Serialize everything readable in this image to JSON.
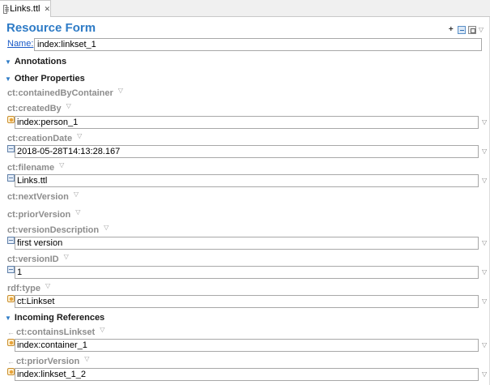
{
  "tab": {
    "title": "Links.ttl",
    "close_glyph": "✕",
    "icon": "turtle-file-icon"
  },
  "form": {
    "title": "Resource Form"
  },
  "toolbar": {
    "add_icon": "add-value-icon",
    "list_icon": "list-view-icon",
    "grid_icon": "grid-view-icon",
    "menu_icon": "chevron-down-icon"
  },
  "name": {
    "label": "Name:",
    "value": "index:linkset_1"
  },
  "sections": {
    "annotations": "Annotations",
    "other_properties": "Other Properties",
    "incoming_references": "Incoming References"
  },
  "properties": {
    "containedByContainer": "ct:containedByContainer",
    "createdBy": {
      "label": "ct:createdBy",
      "value": "index:person_1"
    },
    "creationDate": {
      "label": "ct:creationDate",
      "value": "2018-05-28T14:13:28.167"
    },
    "filename": {
      "label": "ct:filename",
      "value": "Links.ttl"
    },
    "nextVersion": "ct:nextVersion",
    "priorVersion": "ct:priorVersion",
    "versionDescription": {
      "label": "ct:versionDescription",
      "value": "first version"
    },
    "versionID": {
      "label": "ct:versionID",
      "value": "1"
    },
    "rdfType": {
      "label": "rdf:type",
      "value": "ct:Linkset"
    }
  },
  "incoming": {
    "containsLinkset": {
      "label": "ct:containsLinkset",
      "value": "index:container_1"
    },
    "priorVersion": {
      "label": "ct:priorVersion",
      "value": "index:linkset_1_2"
    }
  }
}
